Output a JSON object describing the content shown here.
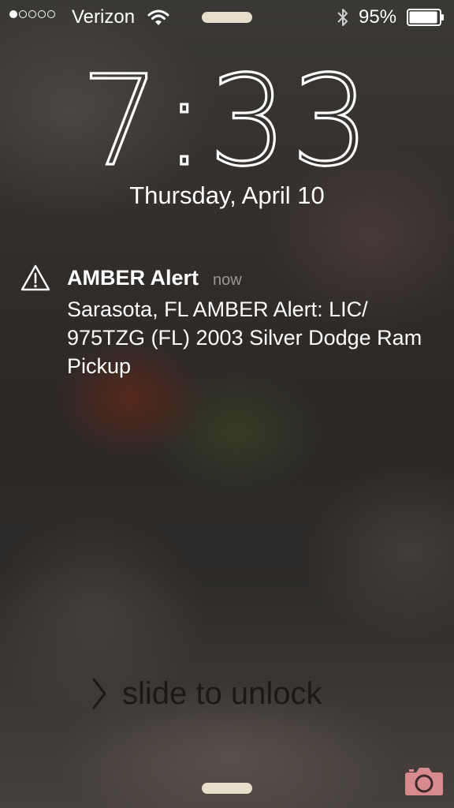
{
  "status_bar": {
    "signal_bars_filled": 1,
    "signal_bars_total": 5,
    "carrier": "Verizon",
    "wifi_icon": "wifi-icon",
    "bluetooth_icon": "bluetooth-icon",
    "battery_percent": "95%",
    "battery_level": 0.95
  },
  "lock_screen": {
    "time": "7:33",
    "date": "Thursday, April 10"
  },
  "notification": {
    "icon": "warning-icon",
    "title": "AMBER Alert",
    "time": "now",
    "body": "Sarasota, FL AMBER Alert: LIC/ 975TZG (FL) 2003 Silver Dodge Ram Pickup"
  },
  "unlock": {
    "label": "slide to unlock"
  },
  "colors": {
    "pill": "#e7dfcc",
    "camera_accent": "#d98a8f"
  },
  "camera_icon": "camera-icon"
}
